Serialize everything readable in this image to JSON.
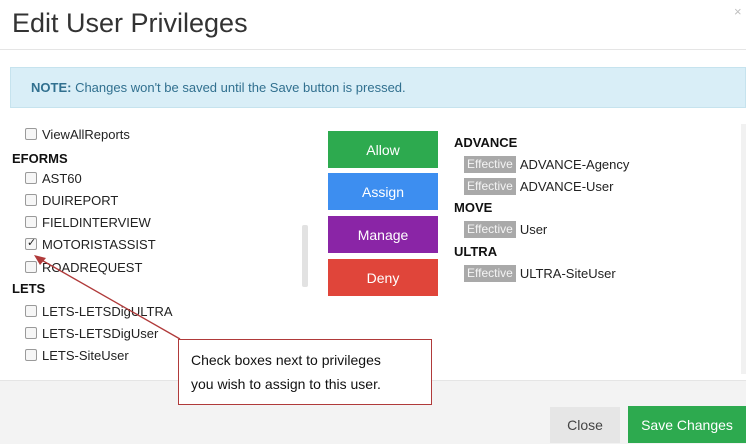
{
  "modal": {
    "title": "Edit User Privileges",
    "close_icon": "close-icon"
  },
  "note": {
    "label": "NOTE:",
    "text": " Changes won't be saved until the Save button is pressed."
  },
  "privileges": {
    "top_item": "ViewAllReports",
    "groups": [
      {
        "name": "EFORMS",
        "items": [
          {
            "label": "AST60",
            "checked": false
          },
          {
            "label": "DUIREPORT",
            "checked": false
          },
          {
            "label": "FIELDINTERVIEW",
            "checked": false
          },
          {
            "label": "MOTORISTASSIST",
            "checked": true
          },
          {
            "label": "ROADREQUEST",
            "checked": false
          }
        ]
      },
      {
        "name": "LETS",
        "items": [
          {
            "label": "LETS-LETSDigULTRA",
            "checked": false
          },
          {
            "label": "LETS-LETSDigUser",
            "checked": false
          },
          {
            "label": "LETS-SiteUser",
            "checked": false
          }
        ]
      }
    ]
  },
  "actions": {
    "allow": "Allow",
    "assign": "Assign",
    "manage": "Manage",
    "deny": "Deny"
  },
  "roles": {
    "badge": "Effective",
    "groups": [
      {
        "name": "ADVANCE",
        "items": [
          "ADVANCE-Agency",
          "ADVANCE-User"
        ]
      },
      {
        "name": "MOVE",
        "items": [
          "User"
        ]
      },
      {
        "name": "ULTRA",
        "items": [
          "ULTRA-SiteUser"
        ]
      }
    ]
  },
  "callout": {
    "line1": "Check boxes next to privileges",
    "line2": "you wish to assign to this user."
  },
  "footer": {
    "close_label": "Close",
    "save_label": "Save Changes"
  },
  "colors": {
    "allow": "#2daa4f",
    "assign": "#3d8ef0",
    "manage": "#8a25a6",
    "deny": "#e0453a",
    "note_bg": "#d9eef7",
    "callout_border": "#b03a3a"
  }
}
